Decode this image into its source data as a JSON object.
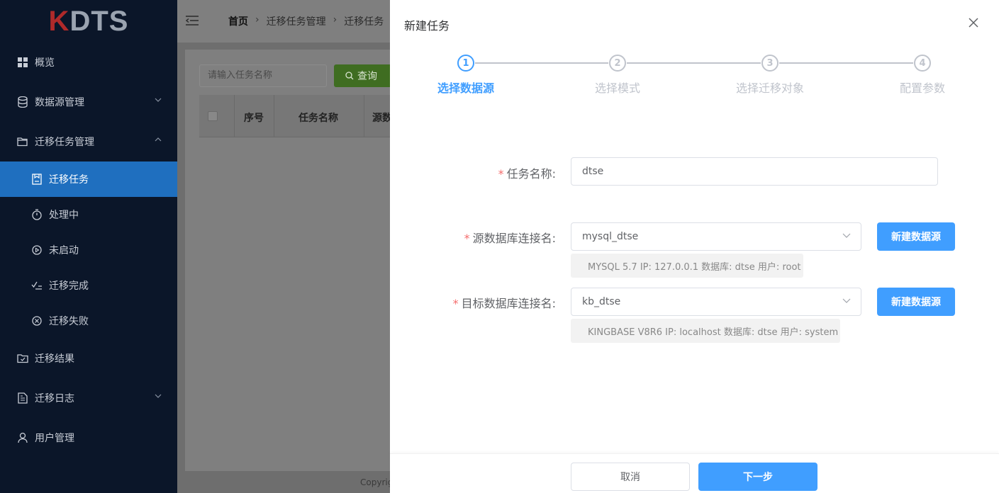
{
  "app": {
    "logo_k": "K",
    "logo_rest": "DTS"
  },
  "sidebar": {
    "items": [
      {
        "label": "概览",
        "icon": "grid-icon"
      },
      {
        "label": "数据源管理",
        "icon": "database-icon",
        "expandable": true
      },
      {
        "label": "迁移任务管理",
        "icon": "folder-open-icon",
        "expandable": true,
        "expanded": true
      },
      {
        "label": "迁移任务",
        "icon": "clipboard-icon",
        "sub": true,
        "active": true
      },
      {
        "label": "处理中",
        "icon": "stopwatch-icon",
        "sub": true
      },
      {
        "label": "未启动",
        "icon": "play-circle-icon",
        "sub": true
      },
      {
        "label": "迁移完成",
        "icon": "check-list-icon",
        "sub": true
      },
      {
        "label": "迁移失败",
        "icon": "x-circle-icon",
        "sub": true
      },
      {
        "label": "迁移结果",
        "icon": "folder-check-icon"
      },
      {
        "label": "迁移日志",
        "icon": "document-icon",
        "expandable": true
      },
      {
        "label": "用户管理",
        "icon": "user-icon"
      }
    ]
  },
  "breadcrumb": [
    "首页",
    "迁移任务管理",
    "迁移任务"
  ],
  "search": {
    "placeholder": "请输入任务名称",
    "query_label": "查询"
  },
  "table": {
    "headers": [
      "序号",
      "任务名称",
      "源数"
    ]
  },
  "footer_text": "Copyrig",
  "drawer": {
    "title": "新建任务",
    "steps": [
      {
        "num": "1",
        "label": "选择数据源",
        "active": true
      },
      {
        "num": "2",
        "label": "选择模式"
      },
      {
        "num": "3",
        "label": "选择迁移对象"
      },
      {
        "num": "4",
        "label": "配置参数"
      }
    ],
    "form": {
      "task_name_label": "任务名称:",
      "task_name_value": "dtse",
      "source_label": "源数据库连接名:",
      "source_value": "mysql_dtse",
      "source_info": "MYSQL 5.7 IP: 127.0.0.1 数据库:  dtse 用户: root",
      "target_label": "目标数据库连接名:",
      "target_value": "kb_dtse",
      "target_info": "KINGBASE V8R6 IP: localhost 数据库:  dtse 用户: system",
      "new_source_button": "新建数据源",
      "required_mark": "*"
    },
    "cancel_label": "取消",
    "next_label": "下一步"
  },
  "colors": {
    "primary": "#409eff",
    "sidebar_bg": "#0b1629",
    "active_menu": "#1f6fbf",
    "required": "#f56c6c"
  }
}
